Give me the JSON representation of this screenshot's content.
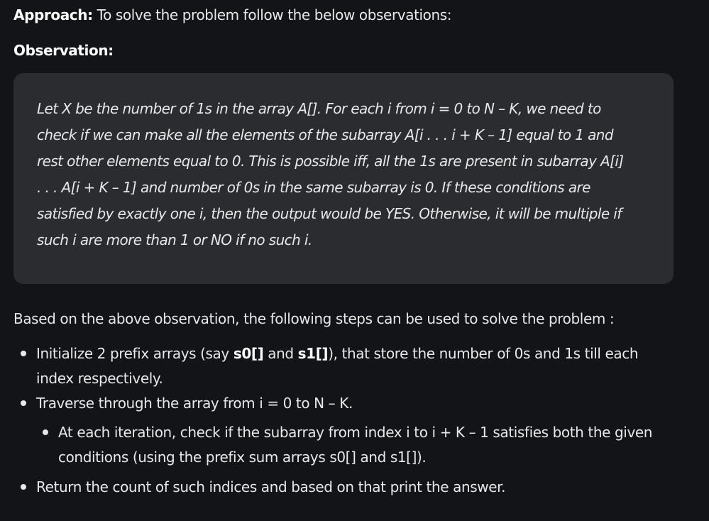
{
  "approach": {
    "label": "Approach:",
    "text": " To solve the problem follow the below observations:"
  },
  "observation": {
    "heading": "Observation:",
    "lines": [
      "Let X be the number of 1s in the array A[]. For each i from i = 0 to N – K, we need to",
      "check if we can make all the elements of the subarray A[i . . . i + K – 1] equal to 1 and",
      "rest other elements equal to 0. This is possible iff, all the 1s are present in subarray A[i]",
      ". . . A[i + K – 1] and number of 0s in the same subarray is 0. If these conditions are",
      "satisfied by exactly one i, then the output would be YES. Otherwise, it will be multiple if",
      "such i are more than 1 or NO if no such i."
    ]
  },
  "steps_intro": "Based on the above observation, the following steps can be used to solve the problem :",
  "steps": {
    "s1": {
      "before": "Initialize 2 prefix arrays (say ",
      "code1": "s0[]",
      "mid": " and ",
      "code2": "s1[]",
      "after": "), that store the number of 0s and 1s till each",
      "line2": "index respectively."
    },
    "s2": "Traverse through the array from i = 0 to N – K.",
    "s2a": {
      "line1": "At each iteration, check if the subarray from index i to i + K – 1 satisfies both the given",
      "line2": "conditions (using the prefix sum arrays s0[] and s1[])."
    },
    "s3": "Return the count of such indices and based on that print the answer."
  }
}
